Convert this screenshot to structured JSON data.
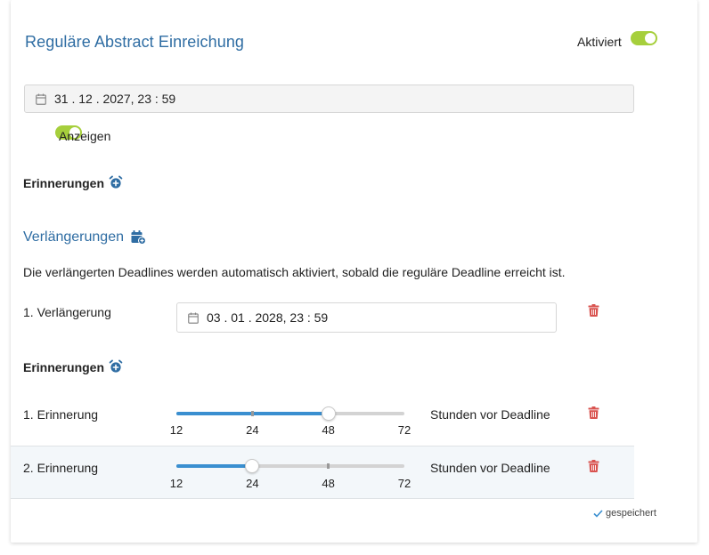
{
  "header": {
    "title": "Reguläre Abstract Einreichung",
    "active_label": "Aktiviert"
  },
  "regular": {
    "date_value": "31 . 12 . 2027, 23 : 59",
    "show_label": "Anzeigen",
    "reminders_label": "Erinnerungen"
  },
  "extensions": {
    "title": "Verlängerungen",
    "description": "Die verlängerten Deadlines werden automatisch aktiviert, sobald die reguläre Deadline erreicht ist.",
    "items": [
      {
        "label": "1. Verlängerung",
        "date_value": "03 . 01 . 2028, 23 : 59"
      }
    ],
    "reminders_label": "Erinnerungen",
    "reminders": [
      {
        "label": "1. Erinnerung",
        "value": 48,
        "unit_label": "Stunden vor Deadline"
      },
      {
        "label": "2. Erinnerung",
        "value": 24,
        "unit_label": "Stunden vor Deadline"
      }
    ],
    "slider_ticks": [
      "12",
      "24",
      "48",
      "72"
    ],
    "slider_tick_values": [
      12,
      24,
      48,
      72
    ]
  },
  "status": {
    "saved_label": "gespeichert"
  },
  "colors": {
    "accent": "#2f6da3",
    "toggle_on": "#a6cf3c",
    "slider_fill": "#3a8fd0",
    "delete": "#d9534f"
  },
  "icons": {
    "date": "calendar-icon",
    "add_reminder": "alarm-clock-plus-icon",
    "add_extension": "calendar-plus-icon",
    "delete": "trash-icon",
    "saved": "check-icon"
  }
}
